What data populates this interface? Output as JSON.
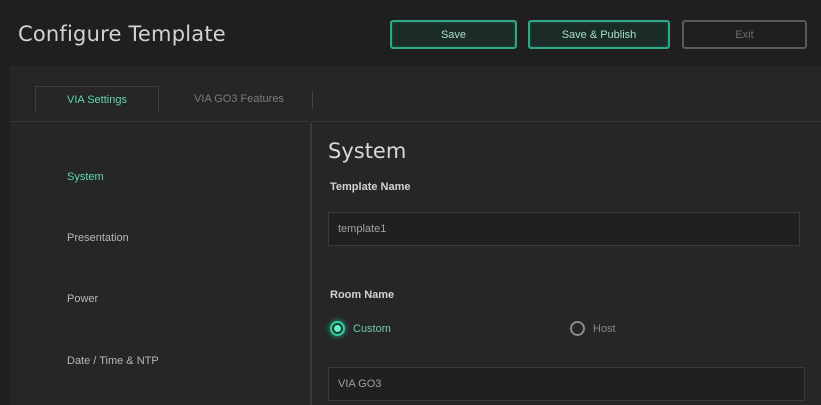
{
  "header": {
    "title": "Configure Template",
    "save_label": "Save",
    "publish_label": "Save & Publish",
    "exit_label": "Exit"
  },
  "tabs": [
    {
      "label": "VIA Settings",
      "active": true
    },
    {
      "label": "VIA GO3 Features",
      "active": false
    }
  ],
  "sidebar": {
    "items": [
      {
        "label": "System",
        "active": true
      },
      {
        "label": "Presentation",
        "active": false
      },
      {
        "label": "Power",
        "active": false
      },
      {
        "label": "Date / Time & NTP",
        "active": false
      }
    ]
  },
  "main": {
    "section_title": "System",
    "template_name_label": "Template Name",
    "template_name_value": "template1",
    "room_name_label": "Room Name",
    "room_name_options": [
      {
        "label": "Custom",
        "checked": true
      },
      {
        "label": "Host",
        "checked": false
      }
    ],
    "room_name_value": "VIA GO3"
  },
  "colors": {
    "accent": "#2fa889",
    "accent_text": "#5fd6b4",
    "background": "#1f1f1f",
    "panel": "#262626"
  }
}
